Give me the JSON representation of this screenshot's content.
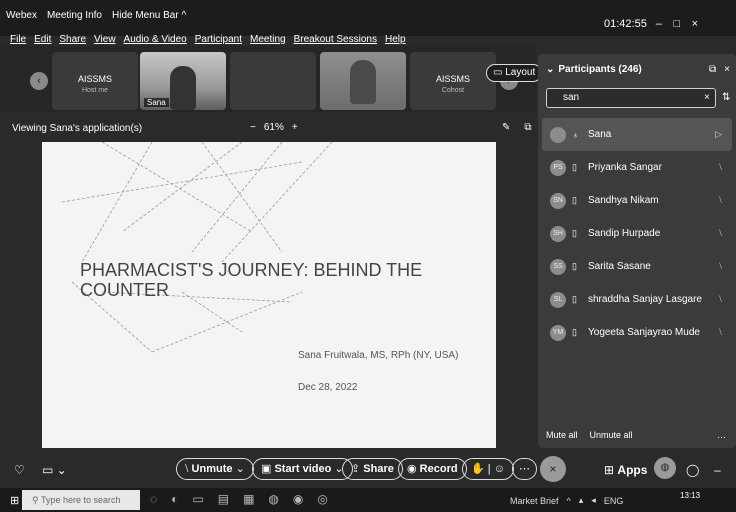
{
  "titlebar": {
    "app": "Webex",
    "meeting_info": "Meeting Info",
    "hide_menu": "Hide Menu Bar ^",
    "menus": [
      "File",
      "Edit",
      "Share",
      "View",
      "Audio & Video",
      "Participant",
      "Meeting",
      "Breakout Sessions",
      "Help"
    ],
    "clock": "01:42:55"
  },
  "strip": {
    "host_tile": {
      "label": "AISSMS",
      "sub": "Host me"
    },
    "sana_tile_name": "Sana",
    "cohost_tile": {
      "label": "AISSMS",
      "sub": "Cohost"
    },
    "layout_label": "Layout"
  },
  "viewbar": {
    "viewing": "Viewing Sana's application(s)",
    "zoom_minus": "−",
    "zoom_level": "61%",
    "zoom_plus": "+"
  },
  "slide": {
    "title": "PHARMACIST'S JOURNEY: BEHIND THE COUNTER",
    "author": "Sana Fruitwala, MS, RPh (NY, USA)",
    "date": "Dec 28, 2022"
  },
  "participants": {
    "header": "Participants (246)",
    "search_value": "san",
    "items": [
      {
        "initials": "",
        "name": "Sana",
        "right": ""
      },
      {
        "initials": "PS",
        "name": "Priyanka Sangar",
        "right": ""
      },
      {
        "initials": "SN",
        "name": "Sandhya Nikam",
        "right": ""
      },
      {
        "initials": "SH",
        "name": "Sandip Hurpade",
        "right": ""
      },
      {
        "initials": "SS",
        "name": "Sarita Sasane",
        "right": ""
      },
      {
        "initials": "SL",
        "name": "shraddha Sanjay Lasgare",
        "right": ""
      },
      {
        "initials": "YM",
        "name": "Yogeeta Sanjayrao Mude",
        "right": ""
      }
    ],
    "mute_all": "Mute all",
    "unmute_all": "Unmute all"
  },
  "controls": {
    "unmute": "Unmute",
    "start_video": "Start video",
    "share": "Share",
    "record": "Record",
    "apps": "Apps"
  },
  "taskbar": {
    "search_placeholder": "Type here to search",
    "weather": "Market Brief",
    "lang": "ENG",
    "time": "13:13"
  }
}
